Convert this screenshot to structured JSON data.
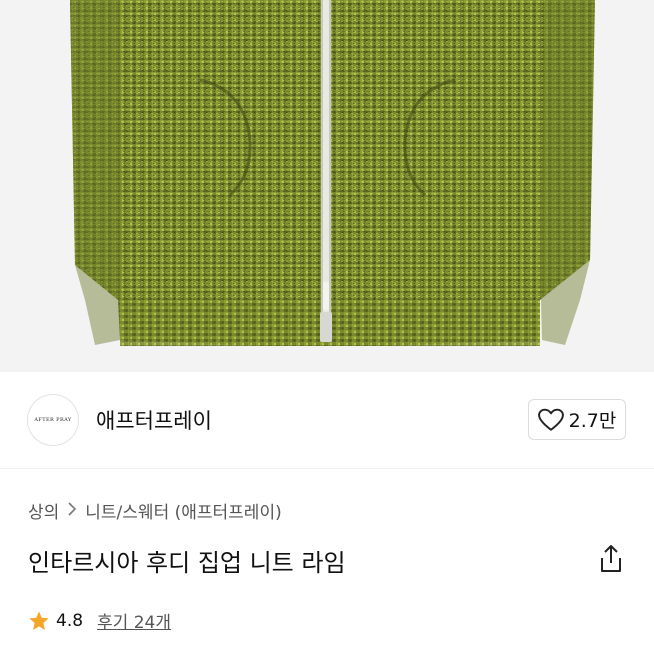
{
  "product": {
    "brand_logo_text": "AFTER PRAY",
    "brand_name": "애프터프레이",
    "like_count": "2.7만",
    "breadcrumb": [
      "상의",
      "니트/스웨터 (애프터프레이)"
    ],
    "title": "인타르시아 후디 집업 니트 라임",
    "rating": "4.8",
    "review_label": "후기 24개"
  },
  "icons": {
    "heart": "heart-outline-icon",
    "share": "share-icon",
    "star": "star-icon",
    "chevron": "chevron-right-icon"
  },
  "colors": {
    "knit_main": "#7a8a2e",
    "knit_dark": "#4f5a1c",
    "knit_light": "#b4c24a",
    "star": "#f4a62a"
  }
}
